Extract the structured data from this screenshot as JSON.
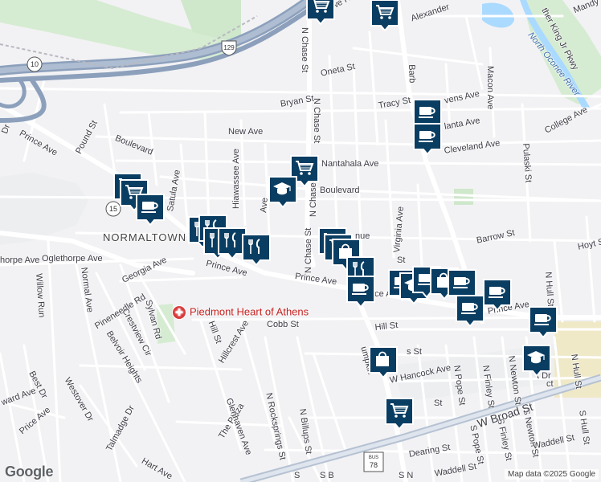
{
  "map": {
    "road_labels": [
      {
        "id": "rowe",
        "text": "Rowe Rd"
      },
      {
        "id": "alexander",
        "text": "Alexander"
      },
      {
        "id": "mandy",
        "text": "Mandy"
      },
      {
        "id": "mlk",
        "text": "ther King Jr Pkwy"
      },
      {
        "id": "oneta",
        "text": "Oneta St"
      },
      {
        "id": "bryan",
        "text": "Bryan St"
      },
      {
        "id": "nchase1",
        "text": "N Chase St"
      },
      {
        "id": "nchase2",
        "text": "N Chase St"
      },
      {
        "id": "nchase3",
        "text": "N Chase St"
      },
      {
        "id": "nchase4",
        "text": "N Chase St"
      },
      {
        "id": "barber",
        "text": "Barb"
      },
      {
        "id": "tracy",
        "text": "Tracy St"
      },
      {
        "id": "macon",
        "text": "Macon Ave"
      },
      {
        "id": "stevens",
        "text": "vens Ave"
      },
      {
        "id": "atlanta",
        "text": "lanta Ave"
      },
      {
        "id": "cleveland",
        "text": "Cleveland Ave"
      },
      {
        "id": "college",
        "text": "College Ave"
      },
      {
        "id": "new",
        "text": "New Ave"
      },
      {
        "id": "nantahala",
        "text": "Nantahala Ave"
      },
      {
        "id": "boulevard1",
        "text": "Boulevard"
      },
      {
        "id": "boulevard2",
        "text": "Boulevard"
      },
      {
        "id": "pound",
        "text": "Pound St"
      },
      {
        "id": "satula",
        "text": "Satula Ave"
      },
      {
        "id": "hiawassee",
        "text": "Hiawassee Ave"
      },
      {
        "id": "prince1",
        "text": "Prince Ave"
      },
      {
        "id": "prince2",
        "text": "Prince Ave"
      },
      {
        "id": "prince3",
        "text": "Prince Ave"
      },
      {
        "id": "prince4",
        "text": "Prince Ave"
      },
      {
        "id": "oglethorpe1",
        "text": "Oglethorpe Ave"
      },
      {
        "id": "oglethorpe2",
        "text": "horpe Ave"
      },
      {
        "id": "georgia",
        "text": "Georgia Ave"
      },
      {
        "id": "virginia",
        "text": "Virginia Ave"
      },
      {
        "id": "barrow",
        "text": "Barrow St"
      },
      {
        "id": "hoyt",
        "text": "Hoyt St"
      },
      {
        "id": "pulaski",
        "text": "Pulaski St"
      },
      {
        "id": "willowrun",
        "text": "Willow Run"
      },
      {
        "id": "normal",
        "text": "Normal Ave"
      },
      {
        "id": "pineneedle",
        "text": "Pineneedle Rd"
      },
      {
        "id": "crestview",
        "text": "Crestview Cir"
      },
      {
        "id": "sylvan",
        "text": "Sylvan Rd"
      },
      {
        "id": "belvoir",
        "text": "Belvoir Heights"
      },
      {
        "id": "hill1",
        "text": "Hill St"
      },
      {
        "id": "hill2",
        "text": "Hill St"
      },
      {
        "id": "cobb",
        "text": "Cobb St"
      },
      {
        "id": "hillcrest",
        "text": "Hillcrest Ave"
      },
      {
        "id": "westover",
        "text": "Westover Dr"
      },
      {
        "id": "best",
        "text": "Best Dr"
      },
      {
        "id": "ward",
        "text": "ward Ave"
      },
      {
        "id": "price",
        "text": "Price Ave"
      },
      {
        "id": "talmadge",
        "text": "Talmadge Dr"
      },
      {
        "id": "plaza",
        "text": "The Plaza"
      },
      {
        "id": "glenhaven",
        "text": "Glenhaven Ave"
      },
      {
        "id": "nrocksprings",
        "text": "N Rocksprings St"
      },
      {
        "id": "nbillups",
        "text": "N Billups St"
      },
      {
        "id": "hart",
        "text": "Hart Ave"
      },
      {
        "id": "whancock",
        "text": "W Hancock Ave"
      },
      {
        "id": "npope",
        "text": "N Pope St"
      },
      {
        "id": "spope",
        "text": "S Pope St"
      },
      {
        "id": "nfinley",
        "text": "N Finley St"
      },
      {
        "id": "sfinley",
        "text": "S Finley St"
      },
      {
        "id": "nnewton",
        "text": "N Newton St"
      },
      {
        "id": "snewton",
        "text": "S Newton St"
      },
      {
        "id": "nhull1",
        "text": "N Hull St"
      },
      {
        "id": "nhull2",
        "text": "N Hull St"
      },
      {
        "id": "shull",
        "text": "S Hull St"
      },
      {
        "id": "wbroad",
        "text": "W Broad St"
      },
      {
        "id": "waddell1",
        "text": "Waddell St"
      },
      {
        "id": "waddell2",
        "text": "Waddell St"
      },
      {
        "id": "dearing",
        "text": "Dearing St"
      },
      {
        "id": "lumpkin",
        "text": "umpkin"
      },
      {
        "id": "dr",
        "text": "Dr"
      },
      {
        "id": "ave_prince",
        "text": "nce Ave"
      },
      {
        "id": "ave_frag",
        "text": "Ave"
      },
      {
        "id": "lumpkin2",
        "text": "nue"
      },
      {
        "id": "st_frag",
        "text": "St"
      },
      {
        "id": "ct_frag",
        "text": "t Dr"
      },
      {
        "id": "sn",
        "text": "S N"
      },
      {
        "id": "sb",
        "text": "S B"
      },
      {
        "id": "s_frag",
        "text": "S"
      },
      {
        "id": "st2",
        "text": "St"
      },
      {
        "id": "s3",
        "text": "s St"
      },
      {
        "id": "ct2",
        "text": "ct"
      }
    ],
    "river_label": "North Oconee River",
    "district_label": "NORMALTOWN",
    "poi": {
      "name": "Piedmont Heart of Athens",
      "icon": "hospital-icon"
    },
    "shields": [
      {
        "id": "us129",
        "text": "129"
      },
      {
        "id": "ga10",
        "text": "10"
      },
      {
        "id": "ga15",
        "text": "15"
      },
      {
        "id": "bus78",
        "top": "BUS",
        "text": "78"
      }
    ],
    "markers": [
      {
        "id": "m1",
        "icon": "cart"
      },
      {
        "id": "m2",
        "icon": "cart"
      },
      {
        "id": "m3",
        "icon": "coffee"
      },
      {
        "id": "m4",
        "icon": "coffee"
      },
      {
        "id": "m5",
        "icon": "cart"
      },
      {
        "id": "m6",
        "icon": "school"
      },
      {
        "id": "m7",
        "icon": "cart"
      },
      {
        "id": "m8",
        "icon": "cart"
      },
      {
        "id": "m9",
        "icon": "coffee"
      },
      {
        "id": "m10",
        "icon": "fork-knife"
      },
      {
        "id": "m11",
        "icon": "fork-knife"
      },
      {
        "id": "m12",
        "icon": "fork-knife"
      },
      {
        "id": "m13",
        "icon": "fork-knife"
      },
      {
        "id": "m14",
        "icon": "fork-knife"
      },
      {
        "id": "m15",
        "icon": "cart"
      },
      {
        "id": "m16",
        "icon": "cart"
      },
      {
        "id": "m17",
        "icon": "bag"
      },
      {
        "id": "m18",
        "icon": "fork-knife"
      },
      {
        "id": "m19",
        "icon": "coffee"
      },
      {
        "id": "m20",
        "icon": "coffee"
      },
      {
        "id": "m21",
        "icon": "school"
      },
      {
        "id": "m22",
        "icon": "coffee"
      },
      {
        "id": "m23",
        "icon": "bag"
      },
      {
        "id": "m24",
        "icon": "coffee"
      },
      {
        "id": "m25",
        "icon": "coffee"
      },
      {
        "id": "m26",
        "icon": "coffee"
      },
      {
        "id": "m27",
        "icon": "coffee"
      },
      {
        "id": "m28",
        "icon": "school"
      },
      {
        "id": "m29",
        "icon": "bag"
      },
      {
        "id": "m30",
        "icon": "cart"
      }
    ],
    "attribution": "Map data ©2025 Google",
    "logo": "Google",
    "colors": {
      "marker": "#0a3d62",
      "highway": "#8ca0bc",
      "park": "#d6ecd2",
      "water": "#aadaff",
      "road": "#ffffff"
    }
  }
}
